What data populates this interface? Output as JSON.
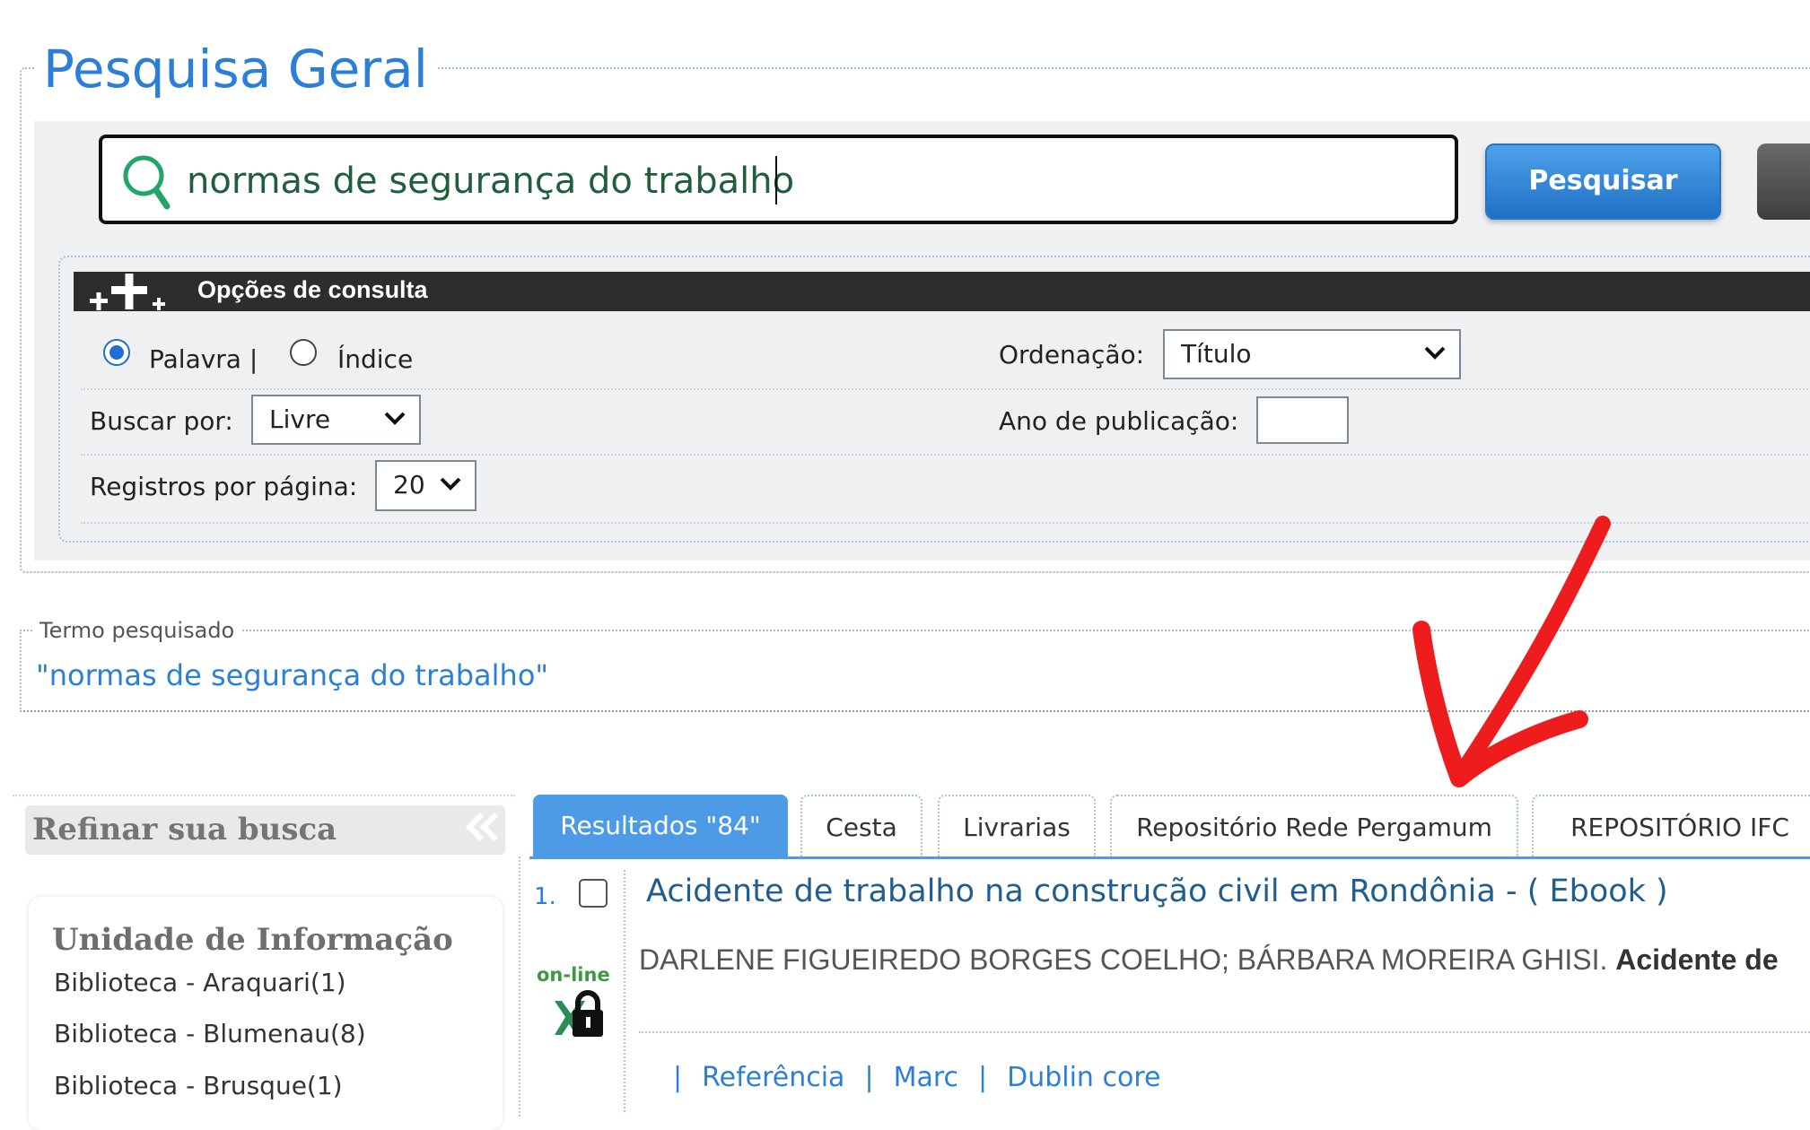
{
  "search": {
    "title": "Pesquisa Geral",
    "query": "normas de segurança do trabalho",
    "search_button": "Pesquisar"
  },
  "options": {
    "header": "Opções de consulta",
    "radio_palavra": "Palavra |",
    "radio_indice": "Índice",
    "ordering_label": "Ordenação:",
    "ordering_value": "Título",
    "search_by_label": "Buscar por:",
    "search_by_value": "Livre",
    "year_label": "Ano de publicação:",
    "per_page_label": "Registros por página:",
    "per_page_value": "20"
  },
  "term": {
    "legend": "Termo pesquisado",
    "value": "\"normas de segurança do trabalho\""
  },
  "refine": {
    "title": "Refinar sua busca",
    "facet_title": "Unidade de Informação",
    "items": [
      "Biblioteca - Araquari(1)",
      "Biblioteca - Blumenau(8)",
      "Biblioteca - Brusque(1)"
    ]
  },
  "tabs": [
    "Resultados \"84\"",
    "Cesta",
    "Livrarias",
    "Repositório Rede Pergamum",
    "REPOSITÓRIO IFC"
  ],
  "result": {
    "number": "1.",
    "title": "Acidente de trabalho na construção civil em Rondônia - ( Ebook )",
    "authors": "DARLENE FIGUEIREDO BORGES COELHO; BÁRBARA MOREIRA GHISI.",
    "authors_bold": "Acidente de",
    "online_label": "on-line",
    "links": [
      "Referência",
      "Marc",
      "Dublin core"
    ]
  },
  "colors": {
    "accent": "#2b7fd8",
    "header_dark": "#2d2d2d",
    "arrow": "#ee1c1c"
  }
}
